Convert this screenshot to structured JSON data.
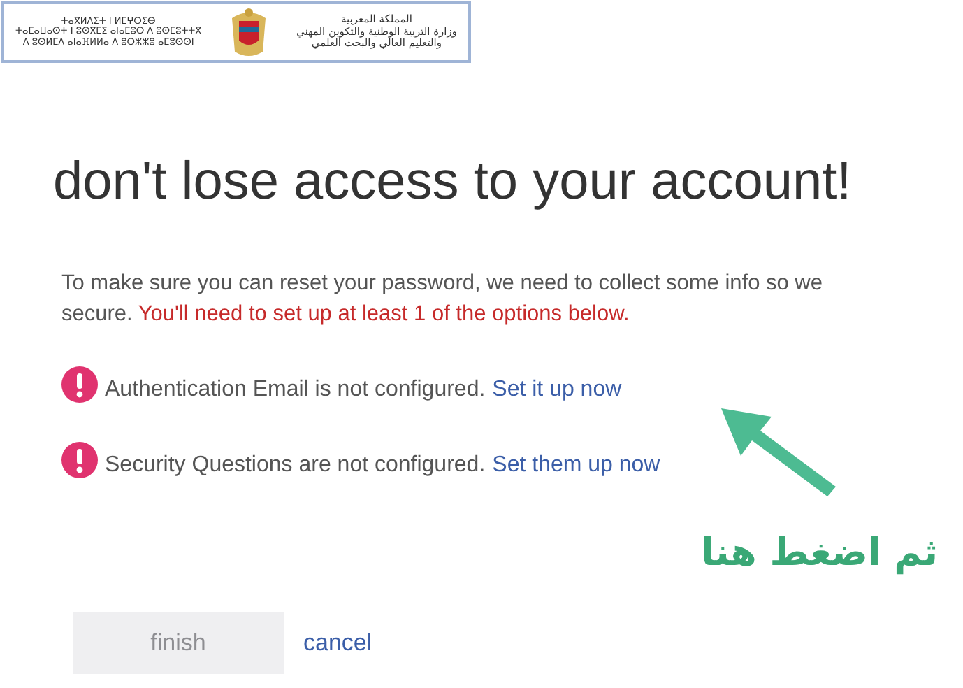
{
  "banner": {
    "tifinagh_lines": [
      "ⵜⴰⴳⵍⴷⵉⵜ ⵏ ⵍⵎⵖⵔⵉⴱ",
      "ⵜⴰⵎⴰⵡⴰⵙⵜ ⵏ ⵓⵙⴳⵎⵉ ⴰⵏⴰⵎⵓⵔ ⴷ ⵓⵙⵎⵓⵜⵜⴳ",
      "ⴷ ⵓⵙⵍⵎⴷ ⴰⵏⴰⴼⵍⵍⴰ ⴷ ⵓⵔⵣⵣⵓ ⴰⵎⵓⵙⵙⵏ"
    ],
    "arabic_lines": [
      "المملكة المغربية",
      "وزارة التربية الوطنية والتكوين المهني",
      "والتعليم العالي والبحث العلمي"
    ]
  },
  "title": "don't lose access to your account!",
  "intro": "To make sure you can reset your password, we need to collect some info so we\nsecure.",
  "warning": "You'll need to set up at least 1 of the options below.",
  "options": [
    {
      "text": "Authentication Email is not configured.",
      "link": "Set it up now",
      "configured": false
    },
    {
      "text": "Security Questions are not configured.",
      "link": "Set them up now",
      "configured": false
    }
  ],
  "annotation": "ثم اضغط هنا",
  "finish": {
    "label": "finish",
    "disabled": true
  },
  "cancel": "cancel"
}
